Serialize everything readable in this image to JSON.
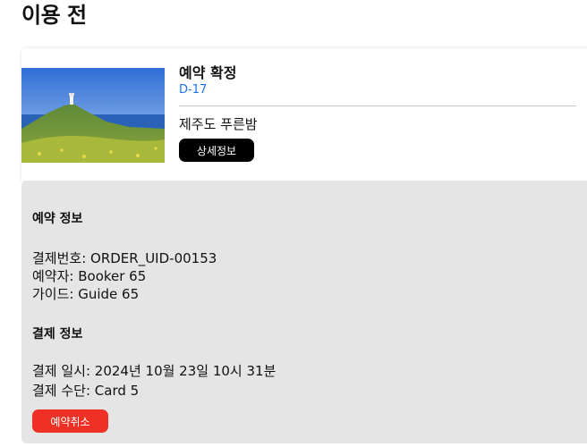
{
  "page": {
    "title": "이용 전"
  },
  "reservation": {
    "status": "예약 확정",
    "dday": "D-17",
    "place_name": "제주도 푸른밤",
    "detail_button_label": "상세정보",
    "image_icon": "landscape-photo"
  },
  "booking_info": {
    "title": "예약 정보",
    "order_number": "결제번호: ORDER_UID-00153",
    "booker": "예약자: Booker 65",
    "guide": "가이드: Guide 65"
  },
  "payment_info": {
    "title": "결제 정보",
    "paid_at": "결제 일시: 2024년 10월 23일 10시 31분",
    "method": "결제 수단: Card 5",
    "cancel_button_label": "예약취소"
  },
  "colors": {
    "dday": "#1a73e8",
    "detail_button": "#000000",
    "cancel_button": "#ee3124",
    "info_background": "#e5e5e5"
  }
}
